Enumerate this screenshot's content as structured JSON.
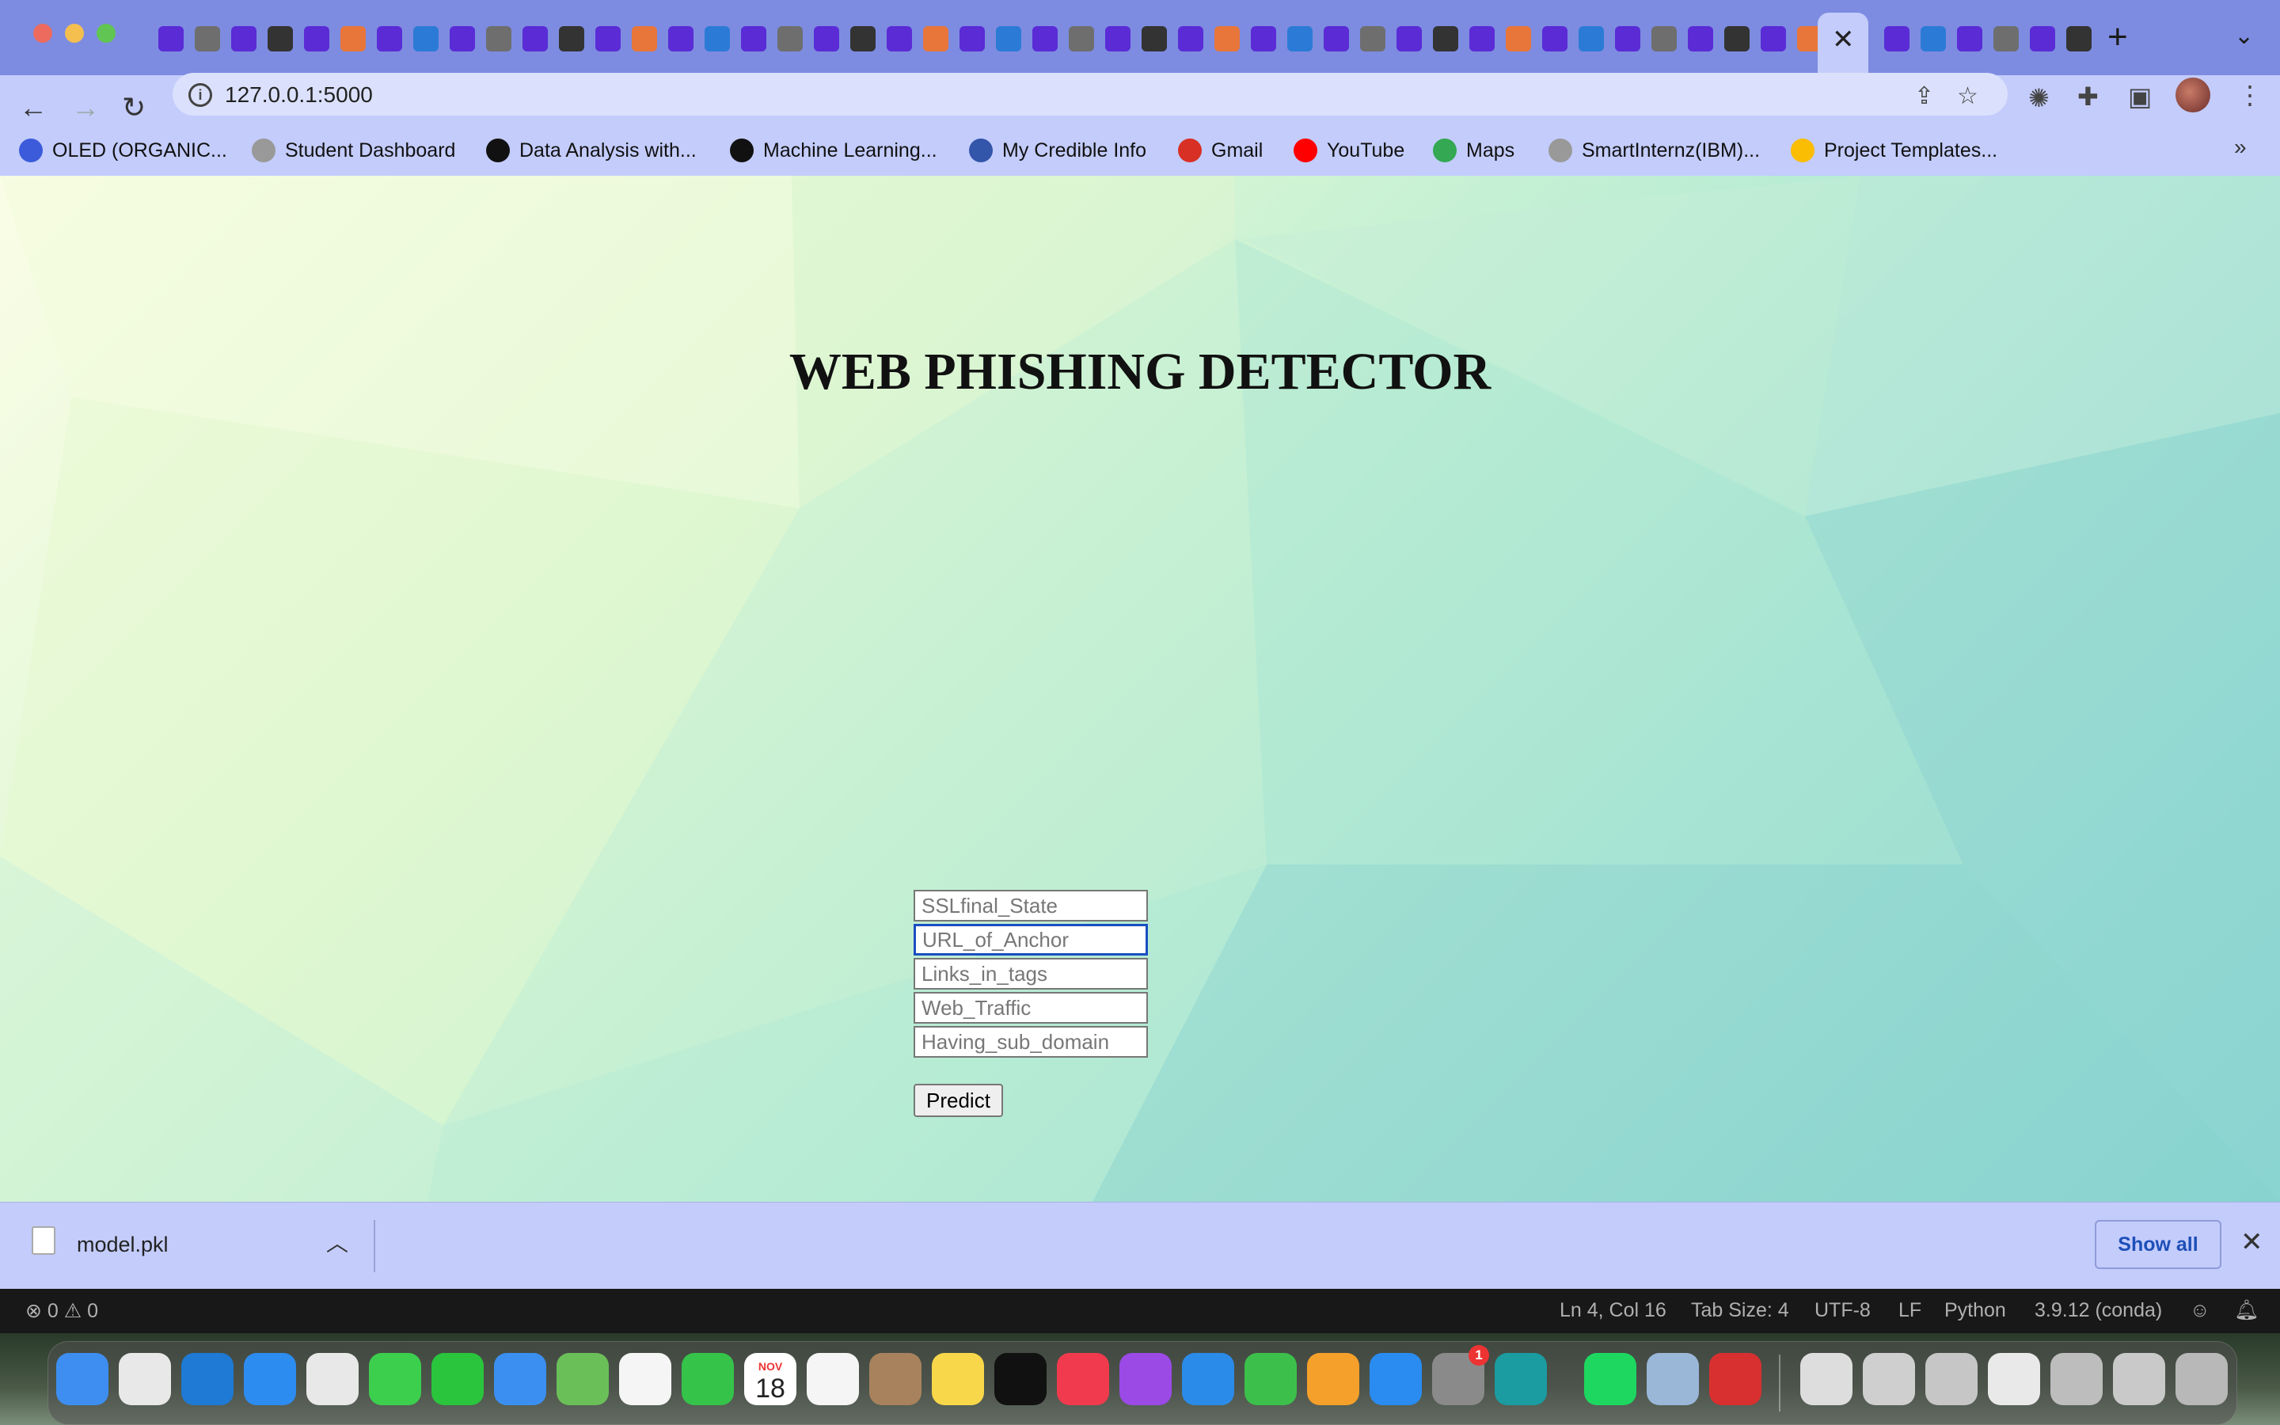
{
  "browser": {
    "url": "127.0.0.1:5000",
    "bookmarks": [
      {
        "label": "OLED (ORGANIC...",
        "icon": "c-circle-icon",
        "color": "#3b5bdb"
      },
      {
        "label": "Student Dashboard",
        "icon": "globe-icon",
        "color": "#999999"
      },
      {
        "label": "Data Analysis with...",
        "icon": "skillsoft-icon",
        "color": "#111111"
      },
      {
        "label": "Machine Learning...",
        "icon": "skillsoft-icon",
        "color": "#111111"
      },
      {
        "label": "My Credible Info",
        "icon": "shield-icon",
        "color": "#3355aa"
      },
      {
        "label": "Gmail",
        "icon": "gmail-icon",
        "color": "#d93025"
      },
      {
        "label": "YouTube",
        "icon": "youtube-icon",
        "color": "#ff0000"
      },
      {
        "label": "Maps",
        "icon": "maps-pin-icon",
        "color": "#34a853"
      },
      {
        "label": "SmartInternz(IBM)...",
        "icon": "globe-icon",
        "color": "#999999"
      },
      {
        "label": "Project Templates...",
        "icon": "google-drive-icon",
        "color": "#fbbc04"
      }
    ]
  },
  "page": {
    "title": "WEB PHISHING DETECTOR",
    "fields": [
      {
        "name": "ssl-final-state-input",
        "placeholder": "SSLfinal_State"
      },
      {
        "name": "url-of-anchor-input",
        "placeholder": "URL_of_Anchor"
      },
      {
        "name": "links-in-tags-input",
        "placeholder": "Links_in_tags"
      },
      {
        "name": "web-traffic-input",
        "placeholder": "Web_Traffic"
      },
      {
        "name": "having-sub-domain-input",
        "placeholder": "Having_sub_domain"
      }
    ],
    "submit_label": "Predict"
  },
  "downloads": {
    "file_name": "model.pkl",
    "show_all_label": "Show all"
  },
  "statusbar": {
    "errors": "0",
    "warnings": "0",
    "position": "Ln 4, Col 16",
    "tab_size": "Tab Size: 4",
    "encoding": "UTF-8",
    "eol": "LF",
    "language": "Python",
    "interpreter": "3.9.12 (conda)"
  },
  "dock": {
    "calendar_month": "NOV",
    "calendar_day": "18",
    "settings_badge": "1",
    "apps": [
      {
        "name": "finder-icon",
        "color": "#3d8ef0"
      },
      {
        "name": "launchpad-icon",
        "color": "#e8e8e8"
      },
      {
        "name": "vscode-icon",
        "color": "#1e7ad4"
      },
      {
        "name": "safari-icon",
        "color": "#2d8cf0"
      },
      {
        "name": "chrome-icon",
        "color": "#e8e8e8"
      },
      {
        "name": "messages-icon",
        "color": "#3ccf4e"
      },
      {
        "name": "whatsapp-icon",
        "color": "#2ac53c"
      },
      {
        "name": "mail-icon",
        "color": "#3b8ff0"
      },
      {
        "name": "maps-icon",
        "color": "#6bbf59"
      },
      {
        "name": "photos-icon",
        "color": "#f5f5f5"
      },
      {
        "name": "facetime-icon",
        "color": "#35c34a"
      },
      {
        "name": "calendar-icon",
        "color": "#ffffff"
      },
      {
        "name": "reminders-icon",
        "color": "#f5f5f5"
      },
      {
        "name": "contacts-icon",
        "color": "#a8825d"
      },
      {
        "name": "notes-icon",
        "color": "#f8d84a"
      },
      {
        "name": "apple-tv-icon",
        "color": "#111111"
      },
      {
        "name": "music-icon",
        "color": "#f23a4e"
      },
      {
        "name": "podcasts-icon",
        "color": "#9b4ae6"
      },
      {
        "name": "keynote-icon",
        "color": "#2b8be8"
      },
      {
        "name": "numbers-icon",
        "color": "#3cc04b"
      },
      {
        "name": "pages-icon",
        "color": "#f5a02a"
      },
      {
        "name": "app-store-icon",
        "color": "#2a8cf0"
      },
      {
        "name": "system-settings-icon",
        "color": "#8a8a8a"
      },
      {
        "name": "arduino-icon",
        "color": "#1a9ca0"
      },
      {
        "name": "spotify-icon",
        "color": "#1ed760"
      },
      {
        "name": "preview-icon",
        "color": "#9ab7d8"
      },
      {
        "name": "photo-booth-icon",
        "color": "#d83030"
      },
      {
        "name": "minimized-window-1-icon",
        "color": "#dddddd"
      },
      {
        "name": "minimized-window-2-icon",
        "color": "#cfcfcf"
      },
      {
        "name": "minimized-window-3-icon",
        "color": "#c6c6c6"
      },
      {
        "name": "minimized-window-4-icon",
        "color": "#e9e9e9"
      },
      {
        "name": "minimized-window-5-icon",
        "color": "#bdbdbd"
      },
      {
        "name": "minimized-window-6-icon",
        "color": "#c9c9c9"
      },
      {
        "name": "trash-icon",
        "color": "#b8b8b8"
      }
    ]
  }
}
